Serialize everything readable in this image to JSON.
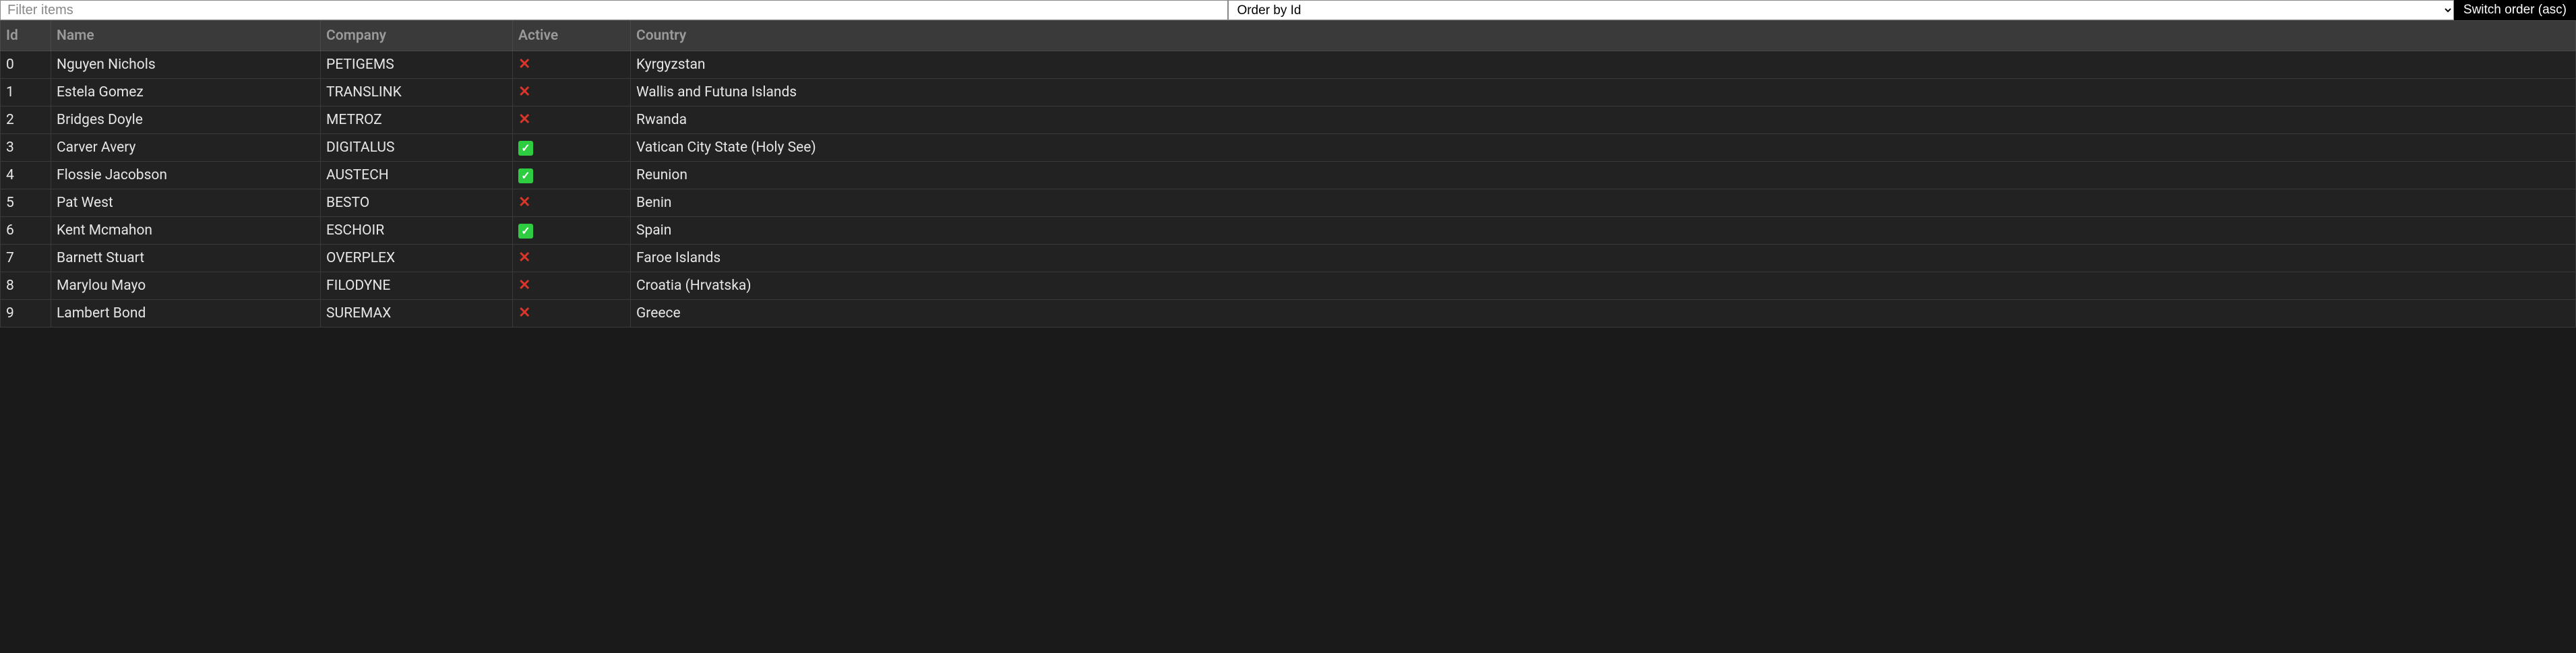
{
  "toolbar": {
    "filter_placeholder": "Filter items",
    "filter_value": "",
    "order_selected": "Order by Id",
    "switch_label": "Switch order (asc)"
  },
  "columns": {
    "id": "Id",
    "name": "Name",
    "company": "Company",
    "active": "Active",
    "country": "Country"
  },
  "rows": [
    {
      "id": "0",
      "name": "Nguyen Nichols",
      "company": "PETIGEMS",
      "active": false,
      "country": "Kyrgyzstan"
    },
    {
      "id": "1",
      "name": "Estela Gomez",
      "company": "TRANSLINK",
      "active": false,
      "country": "Wallis and Futuna Islands"
    },
    {
      "id": "2",
      "name": "Bridges Doyle",
      "company": "METROZ",
      "active": false,
      "country": "Rwanda"
    },
    {
      "id": "3",
      "name": "Carver Avery",
      "company": "DIGITALUS",
      "active": true,
      "country": "Vatican City State (Holy See)"
    },
    {
      "id": "4",
      "name": "Flossie Jacobson",
      "company": "AUSTECH",
      "active": true,
      "country": "Reunion"
    },
    {
      "id": "5",
      "name": "Pat West",
      "company": "BESTO",
      "active": false,
      "country": "Benin"
    },
    {
      "id": "6",
      "name": "Kent Mcmahon",
      "company": "ESCHOIR",
      "active": true,
      "country": "Spain"
    },
    {
      "id": "7",
      "name": "Barnett Stuart",
      "company": "OVERPLEX",
      "active": false,
      "country": "Faroe Islands"
    },
    {
      "id": "8",
      "name": "Marylou Mayo",
      "company": "FILODYNE",
      "active": false,
      "country": "Croatia (Hrvatska)"
    },
    {
      "id": "9",
      "name": "Lambert Bond",
      "company": "SUREMAX",
      "active": false,
      "country": "Greece"
    }
  ]
}
